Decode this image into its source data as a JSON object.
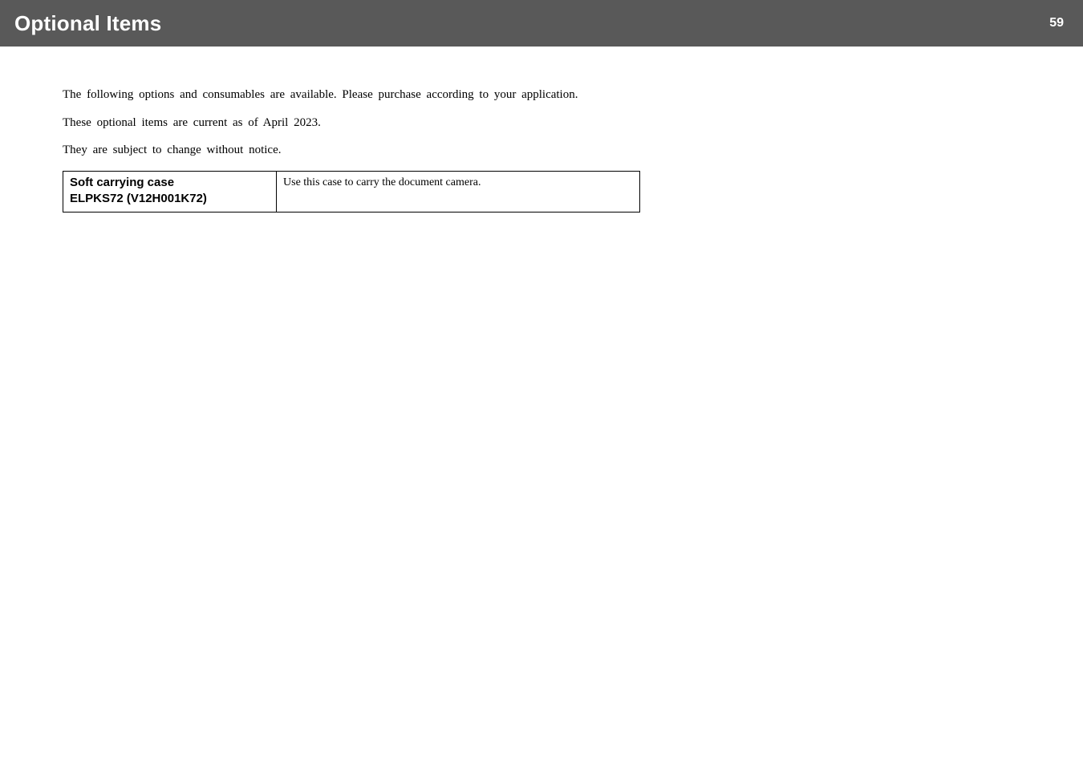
{
  "header": {
    "title": "Optional Items",
    "page_number": "59"
  },
  "body": {
    "p1": "The following options and consumables are available. Please purchase according to your application.",
    "p2": "These optional items are current as of April 2023.",
    "p3": "They are subject to change without notice."
  },
  "table": {
    "rows": [
      {
        "name_line1": "Soft carrying case",
        "name_line2": "ELPKS72 (V12H001K72)",
        "description": "Use this case to carry the document camera."
      }
    ]
  }
}
